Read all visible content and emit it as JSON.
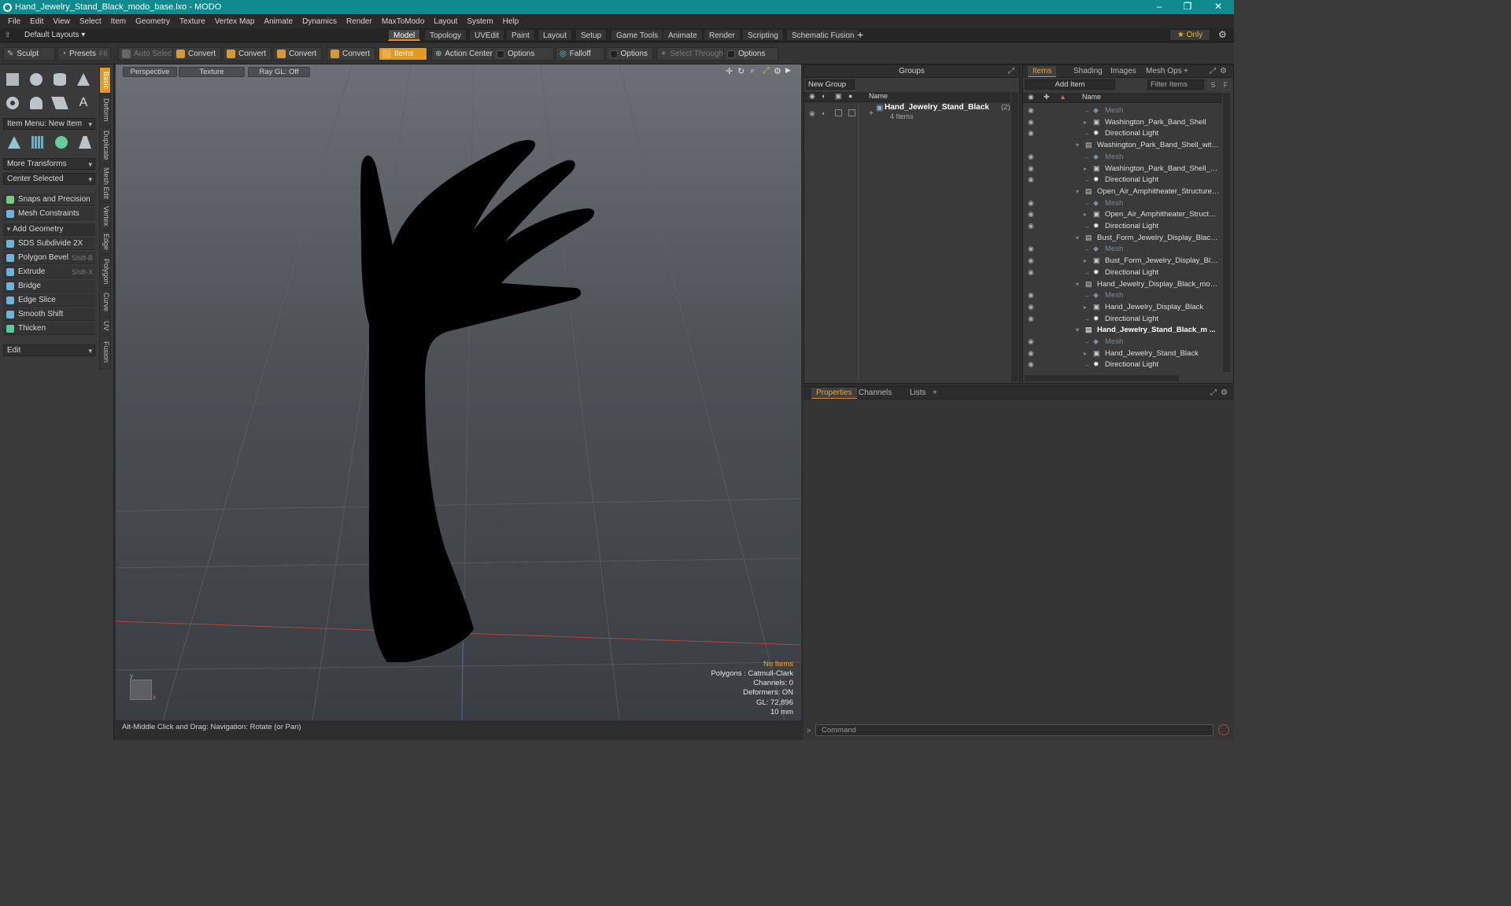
{
  "window": {
    "title": "Hand_Jewelry_Stand_Black_modo_base.lxo - MODO",
    "minimize": "–",
    "maximize": "❐",
    "close": "✕"
  },
  "menubar": [
    "File",
    "Edit",
    "View",
    "Select",
    "Item",
    "Geometry",
    "Texture",
    "Vertex Map",
    "Animate",
    "Dynamics",
    "Render",
    "MaxToModo",
    "Layout",
    "System",
    "Help"
  ],
  "layoutbar": {
    "layouts_dropdown": "Default Layouts ▾",
    "tabs": [
      "Model",
      "Topology",
      "UVEdit",
      "Paint",
      "Layout",
      "Setup",
      "Game Tools",
      "Animate",
      "Render",
      "Scripting",
      "Schematic Fusion"
    ],
    "active_tab": "Model",
    "add": "+",
    "only": "★ Only"
  },
  "toolbar": {
    "sculpt": "Sculpt",
    "presets": "Presets",
    "presets_key": "F6",
    "auto_select": "Auto Select",
    "convert1": "Convert",
    "convert2": "Convert",
    "convert3": "Convert",
    "convert4": "Convert",
    "items": "Items",
    "action_center": "Action Center",
    "options1": "Options",
    "falloff": "Falloff",
    "options2": "Options",
    "select_through": "Select Through",
    "options3": "Options"
  },
  "leftpanel": {
    "item_menu": "Item Menu: New Item",
    "more_transforms": "More Transforms",
    "center_selected": "Center Selected",
    "snaps": "Snaps and Precision",
    "mesh_constraints": "Mesh Constraints",
    "add_geometry": "Add Geometry",
    "tools": [
      {
        "label": "SDS Subdivide 2X",
        "key": ""
      },
      {
        "label": "Polygon Bevel",
        "key": "Shift-B"
      },
      {
        "label": "Extrude",
        "key": "Shift-X"
      },
      {
        "label": "Bridge",
        "key": ""
      },
      {
        "label": "Edge Slice",
        "key": ""
      },
      {
        "label": "Smooth Shift",
        "key": ""
      },
      {
        "label": "Thicken",
        "key": ""
      }
    ],
    "edit": "Edit",
    "vtabs": [
      "Basic",
      "Deform",
      "Duplicate",
      "Mesh Edit",
      "Vertex",
      "Edge",
      "Polygon",
      "Curve",
      "UV",
      "Fusion"
    ]
  },
  "viewport": {
    "perspective": "Perspective",
    "texture": "Texture",
    "raygl": "Ray GL: Off",
    "info": {
      "no_items": "No Items",
      "polygons": "Polygons : Catmull-Clark",
      "channels": "Channels: 0",
      "deformers": "Deformers: ON",
      "gl": "GL: 72,896",
      "unit": "10 mm"
    }
  },
  "statusbar": {
    "hint": "Alt-Middle Click and Drag:  Navigation: Rotate (or Pan)"
  },
  "groups": {
    "title": "Groups",
    "new_group": "New Group",
    "column": "Name",
    "group_name": "Hand_Jewelry_Stand_Black",
    "group_count": "(2)",
    "group_items": "4 Items"
  },
  "items_panel": {
    "tabs": [
      "Items",
      "Shading",
      "Images",
      "Mesh Ops"
    ],
    "add": "+",
    "add_item": "Add Item",
    "filter": "Filter Items",
    "s": "S",
    "f": "F",
    "column": "Name",
    "rows": [
      {
        "text": "Mesh",
        "type": "mesh"
      },
      {
        "text": "Washington_Park_Band_Shell",
        "type": "child"
      },
      {
        "text": "Directional Light",
        "type": "light"
      },
      {
        "text": "Washington_Park_Band_Shell_with_ ...",
        "type": "scene"
      },
      {
        "text": "Mesh",
        "type": "mesh"
      },
      {
        "text": "Washington_Park_Band_Shell_wit ...",
        "type": "child"
      },
      {
        "text": "Directional Light",
        "type": "light"
      },
      {
        "text": "Open_Air_Amphitheater_Structure_ ...",
        "type": "scene"
      },
      {
        "text": "Mesh",
        "type": "mesh"
      },
      {
        "text": "Open_Air_Amphitheater_Structure...",
        "type": "child"
      },
      {
        "text": "Directional Light",
        "type": "light"
      },
      {
        "text": "Bust_Form_Jewelry_Display_Black_m...",
        "type": "scene"
      },
      {
        "text": "Mesh",
        "type": "mesh"
      },
      {
        "text": "Bust_Form_Jewelry_Display_Black",
        "type": "child"
      },
      {
        "text": "Directional Light",
        "type": "light"
      },
      {
        "text": "Hand_Jewelry_Display_Black_modo_ ...",
        "type": "scene"
      },
      {
        "text": "Mesh",
        "type": "mesh"
      },
      {
        "text": "Hand_Jewelry_Display_Black",
        "type": "child"
      },
      {
        "text": "Directional Light",
        "type": "light"
      },
      {
        "text": "Hand_Jewelry_Stand_Black_m ...",
        "type": "scene-bold"
      },
      {
        "text": "Mesh",
        "type": "mesh"
      },
      {
        "text": "Hand_Jewelry_Stand_Black",
        "type": "child"
      },
      {
        "text": "Directional Light",
        "type": "light"
      }
    ]
  },
  "properties": {
    "tabs": [
      "Properties",
      "Channels",
      "Lists"
    ],
    "add": "+",
    "command": "Command"
  },
  "colors": {
    "accent": "#e39a23",
    "title": "#0f8a8f"
  }
}
